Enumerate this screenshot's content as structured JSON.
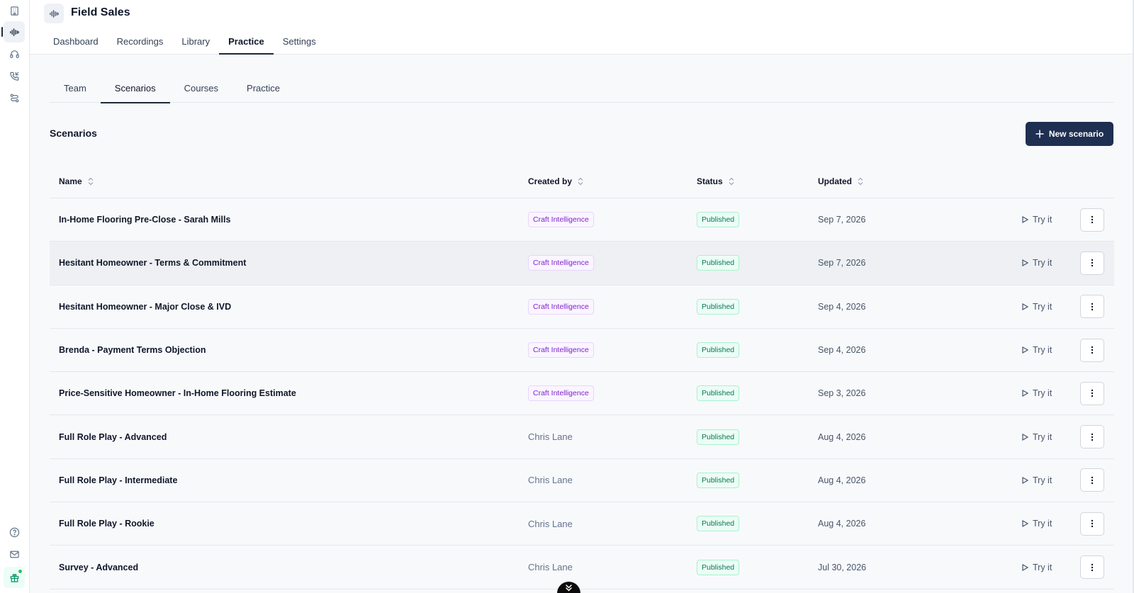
{
  "app": {
    "title": "Field Sales"
  },
  "main_tabs": [
    {
      "label": "Dashboard"
    },
    {
      "label": "Recordings"
    },
    {
      "label": "Library"
    },
    {
      "label": "Practice",
      "active": true
    },
    {
      "label": "Settings"
    }
  ],
  "sub_tabs": [
    {
      "label": "Team"
    },
    {
      "label": "Scenarios",
      "active": true
    },
    {
      "label": "Courses"
    },
    {
      "label": "Practice"
    }
  ],
  "section": {
    "title": "Scenarios",
    "new_button_label": "New scenario"
  },
  "table": {
    "headers": {
      "name": "Name",
      "created_by": "Created by",
      "status": "Status",
      "updated": "Updated"
    },
    "try_label": "Try it",
    "rows": [
      {
        "name": "In-Home Flooring Pre-Close - Sarah Mills",
        "created_by": "Craft Intelligence",
        "status": "Published",
        "updated": "Sep 7, 2026"
      },
      {
        "name": "Hesitant Homeowner - Terms & Commitment",
        "created_by": "Craft Intelligence",
        "status": "Published",
        "updated": "Sep 7, 2026"
      },
      {
        "name": "Hesitant Homeowner - Major Close & IVD",
        "created_by": "Craft Intelligence",
        "status": "Published",
        "updated": "Sep 4, 2026"
      },
      {
        "name": "Brenda - Payment Terms Objection",
        "created_by": "Craft Intelligence",
        "status": "Published",
        "updated": "Sep 4, 2026"
      },
      {
        "name": "Price-Sensitive Homeowner - In-Home Flooring Estimate",
        "created_by": "Craft Intelligence",
        "status": "Published",
        "updated": "Sep 3, 2026"
      },
      {
        "name": "Full Role Play - Advanced",
        "created_by": "Chris Lane",
        "status": "Published",
        "updated": "Aug 4, 2026"
      },
      {
        "name": "Full Role Play - Intermediate",
        "created_by": "Chris Lane",
        "status": "Published",
        "updated": "Aug 4, 2026"
      },
      {
        "name": "Full Role Play - Rookie",
        "created_by": "Chris Lane",
        "status": "Published",
        "updated": "Aug 4, 2026"
      },
      {
        "name": "Survey - Advanced",
        "created_by": "Chris Lane",
        "status": "Published",
        "updated": "Jul 30, 2026"
      }
    ]
  },
  "colors": {
    "primary_button": "#1e2f52",
    "badge_ci_text": "#7e22ce",
    "badge_published_text": "#047857"
  }
}
